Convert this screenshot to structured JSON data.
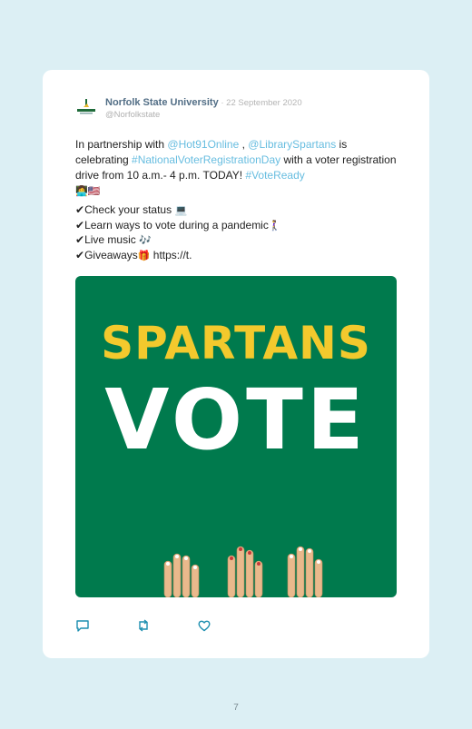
{
  "tweet": {
    "author_name": "Norfolk State University",
    "date_sep": " · ",
    "date": "22 September 2020",
    "handle": "@Norfolkstate",
    "text_parts": [
      "In partnership with ",
      "@Hot91Online",
      " , ",
      "@LibrarySpartans",
      " is celebrating ",
      "#NationalVoterRegistrationDay",
      " with a voter registration drive from 10 a.m.- 4 p.m. TODAY! ",
      "#VoteReady"
    ],
    "text_emoji": "👩‍💻🇺🇸",
    "checklist": [
      {
        "check": "✔",
        "text": "Check your status ",
        "emoji": "💻"
      },
      {
        "check": "✔",
        "text": "Learn ways to vote during a pandemic",
        "emoji": "🚶‍♀️"
      },
      {
        "check": "✔",
        "text": "Live music ",
        "emoji": "🎶"
      },
      {
        "check": "✔",
        "text": "Giveaways",
        "emoji": "🎁",
        "suffix": " https://t."
      }
    ]
  },
  "image": {
    "line1": "SPARTANS",
    "line2": "VOTE",
    "background": "#007a4d",
    "line1_color": "#f3c92d",
    "line2_color": "#ffffff"
  },
  "actions": {
    "icons": [
      "reply-icon",
      "retweet-icon",
      "like-icon"
    ]
  },
  "page": {
    "number": "7"
  }
}
